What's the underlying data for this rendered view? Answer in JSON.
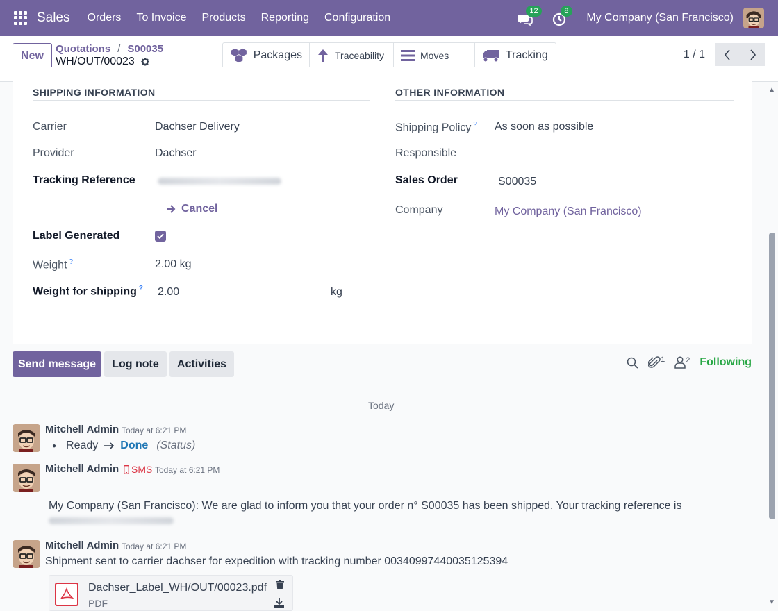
{
  "navbar": {
    "app_name": "Sales",
    "menu": [
      "Orders",
      "To Invoice",
      "Products",
      "Reporting",
      "Configuration"
    ],
    "messages_count": "12",
    "activities_count": "8",
    "company": "My Company (San Francisco)"
  },
  "control_panel": {
    "new_label": "New",
    "breadcrumbs": [
      "Quotations",
      "S00035"
    ],
    "record_name": "WH/OUT/00023",
    "smart_buttons": [
      "Packages",
      "Traceability",
      "Moves",
      "Tracking"
    ],
    "pager": "1 / 1"
  },
  "form": {
    "shipping_title": "SHIPPING INFORMATION",
    "other_title": "OTHER INFORMATION",
    "carrier_label": "Carrier",
    "carrier_value": "Dachser Delivery",
    "provider_label": "Provider",
    "provider_value": "Dachser",
    "tracking_label": "Tracking Reference",
    "cancel_label": "Cancel",
    "label_generated_label": "Label Generated",
    "label_generated_checked": true,
    "weight_label": "Weight",
    "weight_value": "2.00 kg",
    "weight_shipping_label": "Weight for shipping",
    "weight_shipping_value": "2.00",
    "weight_shipping_unit": "kg",
    "help_mark": "?",
    "shipping_policy_label": "Shipping Policy",
    "shipping_policy_value": "As soon as possible",
    "responsible_label": "Responsible",
    "sales_order_label": "Sales Order",
    "sales_order_value": "S00035",
    "company_label": "Company",
    "company_value": "My Company (San Francisco)"
  },
  "chatter": {
    "send_message": "Send message",
    "log_note": "Log note",
    "activities": "Activities",
    "attachments_count": "1",
    "followers_count": "2",
    "following": "Following",
    "date_divider": "Today",
    "messages": [
      {
        "author": "Mitchell Admin",
        "time": "Today at 6:21 PM",
        "from_status": "Ready",
        "to_status": "Done",
        "field": "(Status)"
      },
      {
        "author": "Mitchell Admin",
        "channel": "SMS",
        "time": "Today at 6:21 PM",
        "body": "My Company (San Francisco): We are glad to inform you that your order n° S00035 has been shipped. Your tracking reference is"
      },
      {
        "author": "Mitchell Admin",
        "time": "Today at 6:21 PM",
        "body": "Shipment sent to carrier dachser for expedition with tracking number 00340997440035125394",
        "attachment_name": "Dachser_Label_WH/OUT/00023.pdf",
        "attachment_type": "PDF"
      }
    ]
  },
  "colors": {
    "brand": "#71639e",
    "following": "#28a745",
    "badge": "#26a259",
    "sms": "#dc3545"
  }
}
